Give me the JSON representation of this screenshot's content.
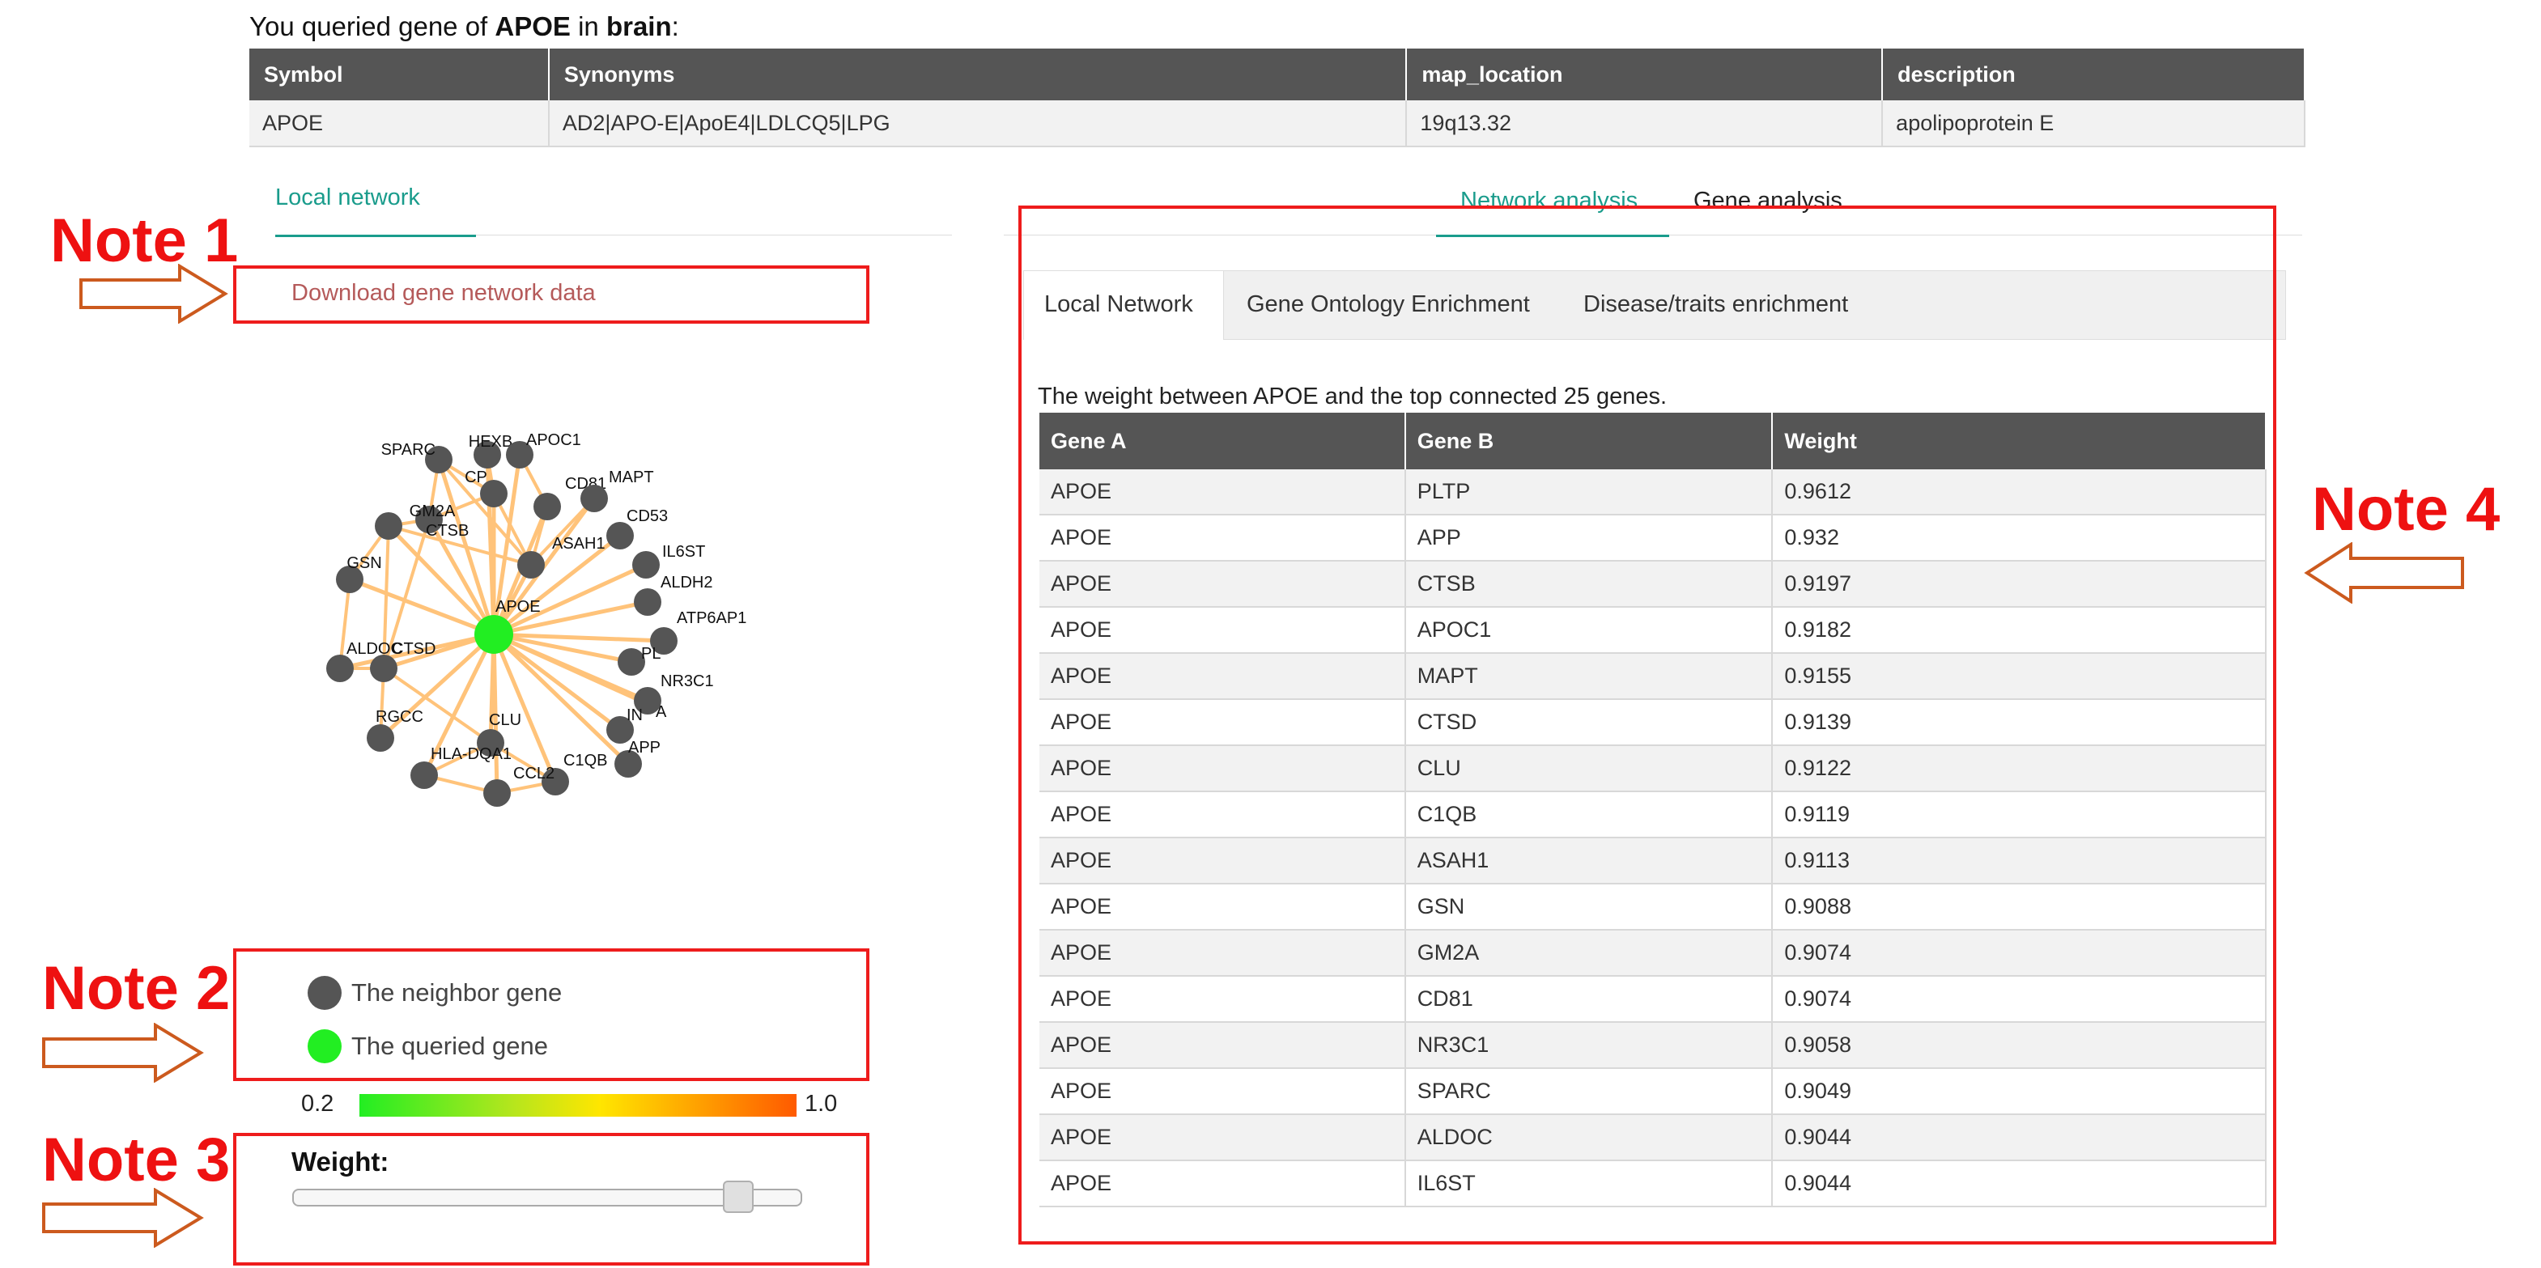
{
  "query": {
    "prefix": "You queried gene of ",
    "gene": "APOE",
    "middle": " in ",
    "tissue": "brain",
    "suffix": ":"
  },
  "gene_info": {
    "headers": [
      "Symbol",
      "Synonyms",
      "map_location",
      "description"
    ],
    "row": [
      "APOE",
      "AD2|APO-E|ApoE4|LDLCQ5|LPG",
      "19q13.32",
      "apolipoprotein E"
    ]
  },
  "left_panel": {
    "tab": "Local network",
    "download_link": "Download gene network data"
  },
  "network": {
    "center": {
      "label": "APOE",
      "color": "#22ee22"
    },
    "neighbor_color": "#555555",
    "edge_color": "#ffc37a",
    "nodes": [
      "SPARC",
      "HEXB",
      "APOC1",
      "CP",
      "CD81",
      "MAPT",
      "GM2A",
      "CD53",
      "CTSB",
      "ASAH1",
      "IL6ST",
      "GSN",
      "ALDH2",
      "ATP6AP1",
      "ALDOC",
      "CTSD",
      "PL",
      "NR3C1",
      "IN",
      "A",
      "RGCC",
      "CLU",
      "APP",
      "HLA-DQA1",
      "C1QB",
      "CCL2"
    ]
  },
  "legend": {
    "neighbor": {
      "label": "The neighbor gene",
      "color": "#555555"
    },
    "queried": {
      "label": "The queried gene",
      "color": "#22ee22"
    }
  },
  "color_scale": {
    "min": "0.2",
    "max": "1.0"
  },
  "weight_slider": {
    "label": "Weight:",
    "value": 0.87
  },
  "notes": [
    "Note 1",
    "Note 2",
    "Note 3",
    "Note 4"
  ],
  "right_panel": {
    "tabs": [
      "Network analysis",
      "Gene analysis"
    ],
    "subtabs": [
      "Local Network",
      "Gene Ontology Enrichment",
      "Disease/traits enrichment"
    ],
    "description": "The weight between APOE and the top connected 25 genes.",
    "table": {
      "headers": [
        "Gene A",
        "Gene B",
        "Weight"
      ],
      "rows": [
        [
          "APOE",
          "PLTP",
          "0.9612"
        ],
        [
          "APOE",
          "APP",
          "0.932"
        ],
        [
          "APOE",
          "CTSB",
          "0.9197"
        ],
        [
          "APOE",
          "APOC1",
          "0.9182"
        ],
        [
          "APOE",
          "MAPT",
          "0.9155"
        ],
        [
          "APOE",
          "CTSD",
          "0.9139"
        ],
        [
          "APOE",
          "CLU",
          "0.9122"
        ],
        [
          "APOE",
          "C1QB",
          "0.9119"
        ],
        [
          "APOE",
          "ASAH1",
          "0.9113"
        ],
        [
          "APOE",
          "GSN",
          "0.9088"
        ],
        [
          "APOE",
          "GM2A",
          "0.9074"
        ],
        [
          "APOE",
          "CD81",
          "0.9074"
        ],
        [
          "APOE",
          "NR3C1",
          "0.9058"
        ],
        [
          "APOE",
          "SPARC",
          "0.9049"
        ],
        [
          "APOE",
          "ALDOC",
          "0.9044"
        ],
        [
          "APOE",
          "IL6ST",
          "0.9044"
        ]
      ]
    }
  },
  "colors": {
    "accent": "#1a9c8c",
    "note_red": "#ee1111",
    "arrow": "#cc5a1e",
    "link": "#b55a5a",
    "table_header": "#555555"
  }
}
